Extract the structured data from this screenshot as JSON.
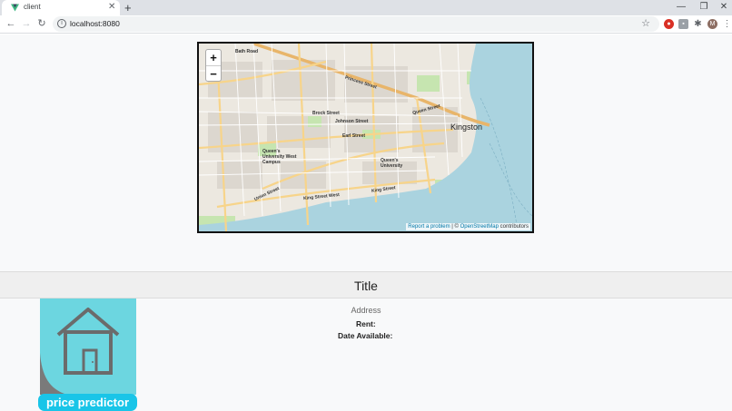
{
  "browser": {
    "tab_title": "client",
    "tab_close": "✕",
    "new_tab": "+",
    "url": "localhost:8080",
    "window_controls": {
      "minimize": "—",
      "restore": "❐",
      "close": "✕"
    },
    "profile_initial": "M",
    "icons": [
      "back-icon",
      "forward-icon",
      "reload-icon",
      "info-icon",
      "star-icon",
      "extension-icon",
      "menu-icon"
    ]
  },
  "map": {
    "zoom_in": "+",
    "zoom_out": "−",
    "attribution_report": "Report a problem",
    "attribution_sep": " | © ",
    "attribution_osm": "OpenStreetMap",
    "attribution_tail": " contributors",
    "labels": {
      "bath_road": "Bath Road",
      "princess_street": "Princess Street",
      "brock_street": "Brock Street",
      "johnson_street": "Johnson Street",
      "earl_street": "Earl Street",
      "queens_west": "Queen's University West Campus",
      "union_street": "Union Street",
      "queens_univ": "Queen's University",
      "king_street_west": "King Street West",
      "king_street": "King Street",
      "kingston": "Kingston",
      "queen_street": "Queen Street"
    },
    "colors": {
      "water": "#aad3df",
      "land": "#f2efe9",
      "park": "#c8e6b0",
      "major_road": "#f7d48a",
      "minor_road": "#ffffff"
    }
  },
  "listing": {
    "title": "Title",
    "address": "Address",
    "rent_label": "Rent:",
    "date_label": "Date Available:",
    "predictor_button": "price predictor",
    "colors": {
      "thumb": "#6cd6e0",
      "button": "#19c5e8"
    }
  }
}
